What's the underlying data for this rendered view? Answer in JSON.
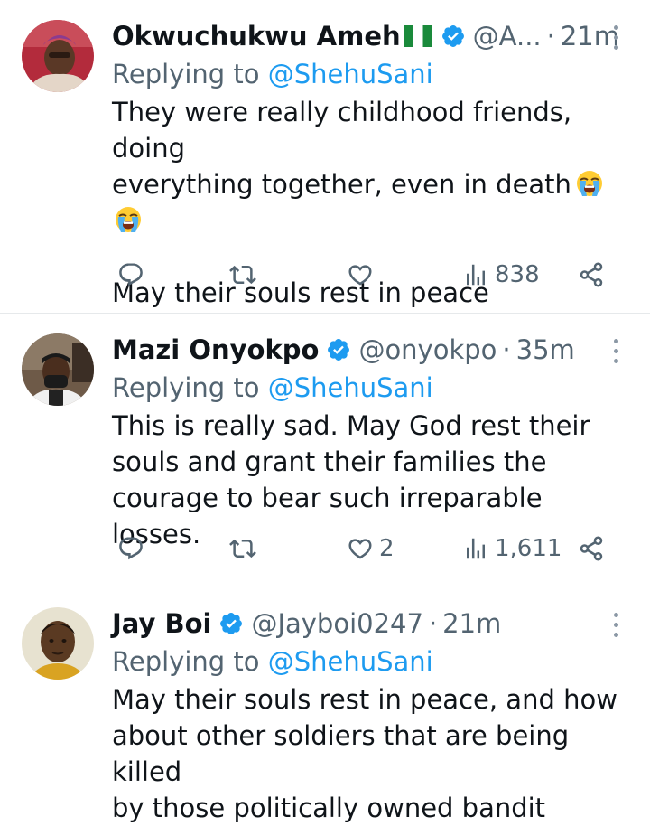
{
  "replying_label": "Replying to",
  "tweets": [
    {
      "author": "Okwuchukwu Ameh",
      "flag": "nigeria-flag",
      "handle": "@A...",
      "time": "21m",
      "reply_to": "@ShehuSani",
      "text_line1": "They were really childhood friends, doing",
      "text_line2": "everything together, even in death",
      "emoji": "loudly-crying-face",
      "text_para2": "May their souls rest in peace",
      "likes": "",
      "views": "838"
    },
    {
      "author": "Mazi Onyokpo",
      "handle": "@onyokpo",
      "time": "35m",
      "reply_to": "@ShehuSani",
      "text": "This is really sad. May God rest their\nsouls and grant their families the\ncourage to bear such irreparable losses.",
      "likes": "2",
      "views": "1,611"
    },
    {
      "author": "Jay Boi",
      "handle": "@Jayboi0247",
      "time": "21m",
      "reply_to": "@ShehuSani",
      "text": "May their souls rest in peace, and how\nabout other soldiers that are being killed\nby those politically owned bandit"
    }
  ],
  "colors": {
    "accent": "#1d9bf0",
    "secondary_text": "#536471",
    "primary_text": "#0f1419",
    "divider": "#e6e9eb"
  }
}
